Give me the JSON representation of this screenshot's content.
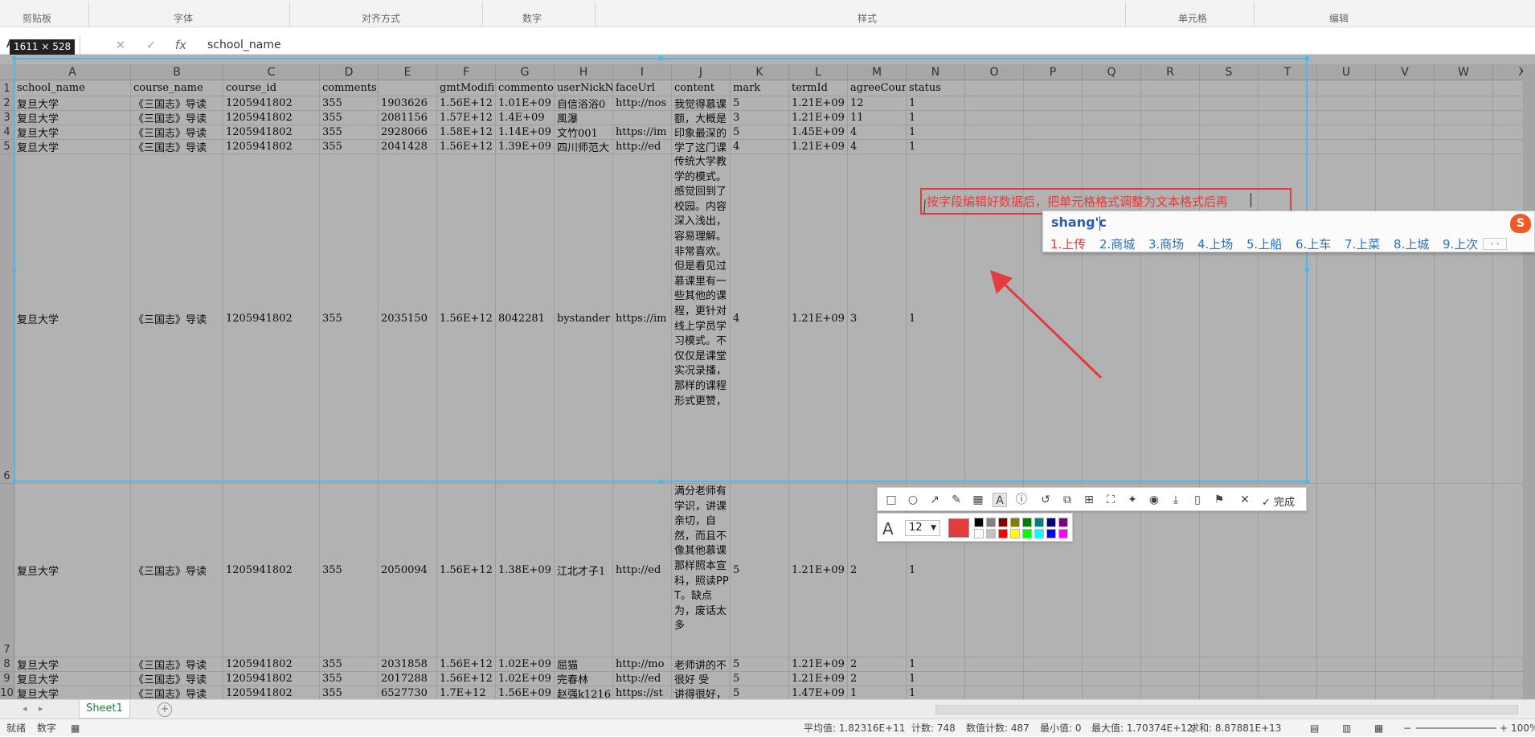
{
  "ribbon": {
    "groups": [
      "剪贴板",
      "字体",
      "对齐方式",
      "数字",
      "样式",
      "单元格",
      "编辑"
    ]
  },
  "formula_bar": {
    "name_box": "A1",
    "value": "school_name"
  },
  "columns": [
    "A",
    "B",
    "C",
    "D",
    "E",
    "F",
    "G",
    "H",
    "I",
    "J",
    "K",
    "L",
    "M",
    "N",
    "O",
    "P",
    "Q",
    "R",
    "S",
    "T",
    "U",
    "V",
    "W",
    "X"
  ],
  "headers": [
    "school_name",
    "course_name",
    "course_id",
    "comments_id",
    "",
    "gmtModifi",
    "commentor",
    "userNickN",
    "faceUrl",
    "content",
    "mark",
    "termId",
    "agreeCour",
    "status"
  ],
  "rows": [
    {
      "num": "2",
      "cells": [
        "复旦大学",
        "《三国志》导读",
        "1205941802",
        "355",
        "1903626",
        "1.56E+12",
        "1.01E+09",
        "自信浴浴0",
        "http://nos",
        "我觉得慕课",
        "5",
        "1.21E+09",
        "12",
        "1"
      ]
    },
    {
      "num": "3",
      "cells": [
        "复旦大学",
        "《三国志》导读",
        "1205941802",
        "355",
        "2081156",
        "1.57E+12",
        "1.4E+09",
        "風瀑",
        "",
        "额，大概是",
        "3",
        "1.21E+09",
        "11",
        "1"
      ]
    },
    {
      "num": "4",
      "cells": [
        "复旦大学",
        "《三国志》导读",
        "1205941802",
        "355",
        "2928066",
        "1.58E+12",
        "1.14E+09",
        "文竹001",
        "https://im",
        "印象最深的",
        "5",
        "1.45E+09",
        "4",
        "1"
      ]
    },
    {
      "num": "5",
      "cells": [
        "复旦大学",
        "《三国志》导读",
        "1205941802",
        "355",
        "2041428",
        "1.56E+12",
        "1.39E+09",
        "四川师范大",
        "http://ed",
        "学了这门课",
        "4",
        "1.21E+09",
        "4",
        "1"
      ]
    },
    {
      "num": "6",
      "cells": [
        "复旦大学",
        "《三国志》导读",
        "1205941802",
        "355",
        "2035150",
        "1.56E+12",
        "8042281",
        "bystander",
        "https://im",
        "传统大学教学的模式。感觉回到了校园。内容深入浅出，容易理解。非常喜欢。但是看见过慕课里有一些其他的课程，更针对线上学员学习模式。不仅仅是课堂实况录播，那样的课程形式更赞，",
        "4",
        "1.21E+09",
        "3",
        "1"
      ]
    },
    {
      "num": "7",
      "cells": [
        "复旦大学",
        "《三国志》导读",
        "1205941802",
        "355",
        "2050094",
        "1.56E+12",
        "1.38E+09",
        "江北才子1",
        "http://ed",
        "满分老师有学识，讲课亲切，自然，而且不像其他慕课那样照本宣科，照读PPT。缺点为，废话太多",
        "5",
        "1.21E+09",
        "2",
        "1"
      ]
    },
    {
      "num": "8",
      "cells": [
        "复旦大学",
        "《三国志》导读",
        "1205941802",
        "355",
        "2031858",
        "1.56E+12",
        "1.02E+09",
        "屈猫",
        "http://mo",
        "老师讲的不",
        "5",
        "1.21E+09",
        "2",
        "1"
      ]
    },
    {
      "num": "9",
      "cells": [
        "复旦大学",
        "《三国志》导读",
        "1205941802",
        "355",
        "2017288",
        "1.56E+12",
        "1.02E+09",
        "完春林",
        "http://ed",
        "很好    受",
        "5",
        "1.21E+09",
        "2",
        "1"
      ]
    },
    {
      "num": "10",
      "cells": [
        "复旦大学",
        "《三国志》导读",
        "1205941802",
        "355",
        "6527730",
        "1.7E+12",
        "1.56E+09",
        "赵强k1216",
        "https://st",
        "讲得很好，",
        "5",
        "1.47E+09",
        "1",
        "1"
      ]
    }
  ],
  "selection": {
    "size_label": "1611 × 528"
  },
  "annotation": {
    "text": "按字段编辑好数据后，把单元格格式调整为文本格式后再"
  },
  "ime": {
    "pinyin": "shang'c",
    "candidates": [
      "1.上传",
      "2.商城",
      "3.商场",
      "4.上场",
      "5.上船",
      "6.上车",
      "7.上菜",
      "8.上城",
      "9.上次"
    ],
    "nav": "‹ ›",
    "logo": "S"
  },
  "toolbar": {
    "done_label": "完成",
    "font_size": "12",
    "current_color": "#e23c3c"
  },
  "palette": [
    "#000000",
    "#808080",
    "#800000",
    "#808000",
    "#008000",
    "#008080",
    "#000080",
    "#800080",
    "#ffffff",
    "#c0c0c0",
    "#ff0000",
    "#ffff00",
    "#00ff00",
    "#00ffff",
    "#0000ff",
    "#ff00ff"
  ],
  "sheet_tabs": {
    "active": "Sheet1"
  },
  "status_bar": {
    "left1": "就绪",
    "left2": "数字",
    "avg": "平均值: 1.82316E+11",
    "count": "计数: 748",
    "numcount": "数值计数: 487",
    "min": "最小值: 0",
    "max": "最大值: 1.70374E+12",
    "sum": "求和: 8.87881E+13",
    "zoom": "100%"
  }
}
